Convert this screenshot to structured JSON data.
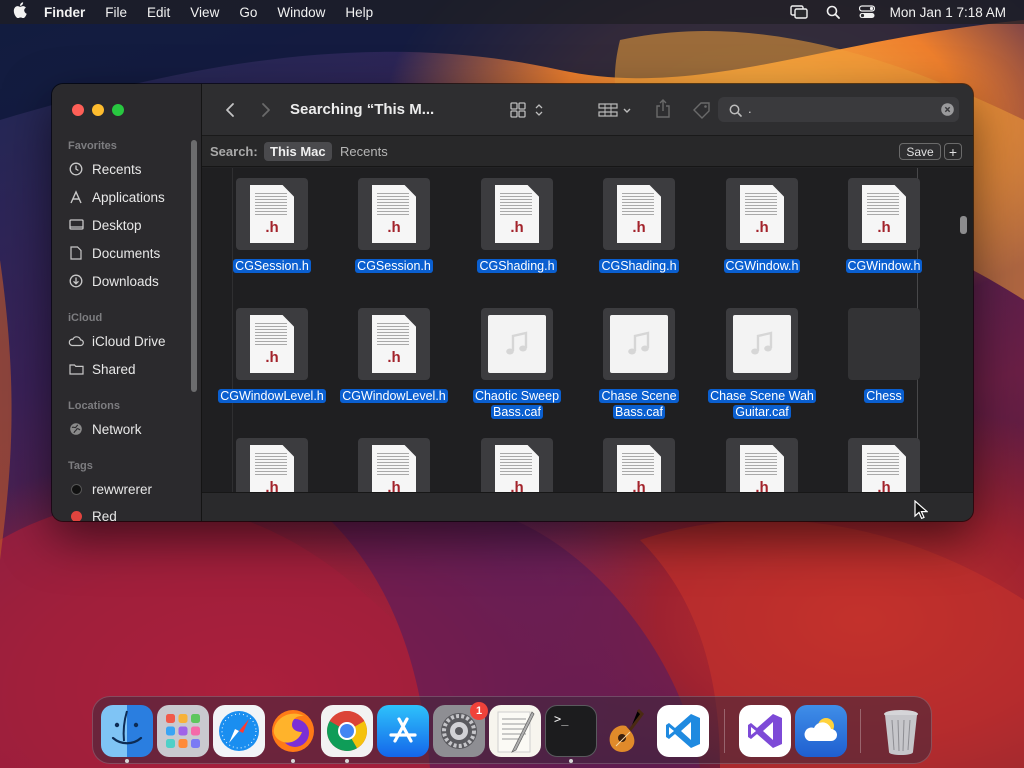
{
  "menubar": {
    "app_name": "Finder",
    "menus": [
      "File",
      "Edit",
      "View",
      "Go",
      "Window",
      "Help"
    ],
    "clock": "Mon Jan 1  7:18 AM",
    "status_icons": [
      "screen-mirroring-icon",
      "search-icon",
      "control-center-icon"
    ]
  },
  "finder": {
    "title": "Searching “This M...",
    "search_value": ".",
    "scope": {
      "label": "Search:",
      "active": "This Mac",
      "other": "Recents",
      "save": "Save",
      "add": "+"
    },
    "sidebar": {
      "favorites_label": "Favorites",
      "favorites": [
        {
          "label": "Recents",
          "icon": "clock-icon"
        },
        {
          "label": "Applications",
          "icon": "applications-icon"
        },
        {
          "label": "Desktop",
          "icon": "desktop-icon"
        },
        {
          "label": "Documents",
          "icon": "document-icon"
        },
        {
          "label": "Downloads",
          "icon": "download-icon"
        }
      ],
      "icloud_label": "iCloud",
      "icloud": [
        {
          "label": "iCloud Drive",
          "icon": "cloud-icon"
        },
        {
          "label": "Shared",
          "icon": "shared-folder-icon"
        }
      ],
      "locations_label": "Locations",
      "locations": [
        {
          "label": "Network",
          "icon": "globe-icon"
        }
      ],
      "tags_label": "Tags",
      "tags": [
        {
          "label": "rewwrerer",
          "color": "#111111"
        },
        {
          "label": "Red",
          "color": "#e0443e"
        }
      ]
    },
    "files_row1": [
      {
        "name": "CGSession.h",
        "kind": "header"
      },
      {
        "name": "CGSession.h",
        "kind": "header"
      },
      {
        "name": "CGShading.h",
        "kind": "header"
      },
      {
        "name": "CGShading.h",
        "kind": "header"
      },
      {
        "name": "CGWindow.h",
        "kind": "header"
      },
      {
        "name": "CGWindow.h",
        "kind": "header"
      }
    ],
    "files_row2": [
      {
        "name": "CGWindowLevel.h",
        "kind": "header"
      },
      {
        "name": "CGWindowLevel.h",
        "kind": "header"
      },
      {
        "name": "Chaotic Sweep Bass.caf",
        "kind": "audio"
      },
      {
        "name": "Chase Scene Bass.caf",
        "kind": "audio"
      },
      {
        "name": "Chase Scene Wah Guitar.caf",
        "kind": "audio"
      },
      {
        "name": "Chess",
        "kind": "app"
      }
    ],
    "files_row3": [
      {
        "name": "",
        "kind": "header"
      },
      {
        "name": "",
        "kind": "header"
      },
      {
        "name": "",
        "kind": "header"
      },
      {
        "name": "",
        "kind": "header"
      },
      {
        "name": "",
        "kind": "header"
      },
      {
        "name": "",
        "kind": "header"
      }
    ],
    "header_ext": ".h"
  },
  "dock": {
    "apps": [
      "Finder",
      "Launchpad",
      "Safari",
      "Firefox",
      "Google Chrome",
      "App Store",
      "System Settings",
      "TextEdit",
      "Terminal",
      "GarageBand",
      "Visual Studio Code",
      "Visual Studio",
      "Weather",
      "Trash"
    ],
    "settings_badge": "1",
    "terminal_prompt": ">_"
  },
  "colors": {
    "selection": "#0a5fd0",
    "close": "#fe5f57",
    "minimize": "#febc2e",
    "zoom": "#28c840"
  }
}
